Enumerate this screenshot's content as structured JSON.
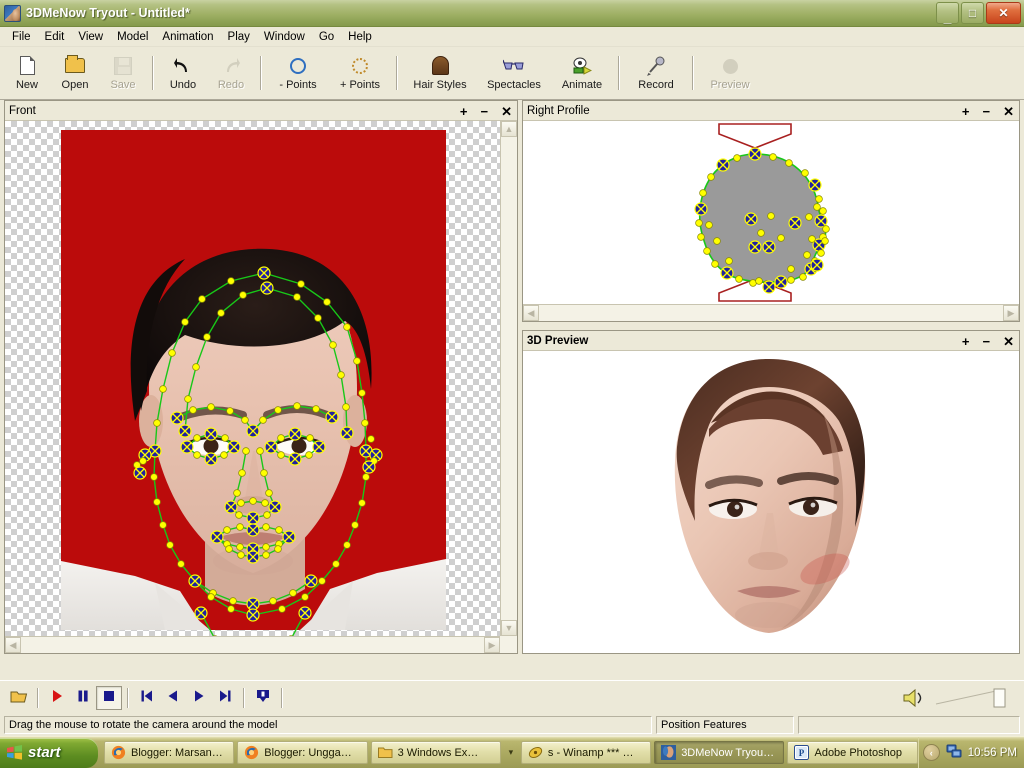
{
  "window": {
    "title": "3DMeNow Tryout  - Untitled*",
    "icon": "app-face-icon",
    "controls": {
      "minimize": "_",
      "maximize": "□",
      "close": "✕"
    }
  },
  "menubar": {
    "items": [
      "File",
      "Edit",
      "View",
      "Model",
      "Animation",
      "Play",
      "Window",
      "Go",
      "Help"
    ]
  },
  "toolbar": {
    "buttons": [
      {
        "label": "New",
        "icon": "new-document-icon",
        "disabled": false
      },
      {
        "label": "Open",
        "icon": "open-folder-icon",
        "disabled": false
      },
      {
        "label": "Save",
        "icon": "floppy-disk-icon",
        "disabled": true
      },
      {
        "label": "Undo",
        "icon": "undo-arrow-icon",
        "disabled": false
      },
      {
        "label": "Redo",
        "icon": "redo-arrow-icon",
        "disabled": true
      },
      {
        "label": "- Points",
        "icon": "minus-points-icon",
        "disabled": false
      },
      {
        "label": "+ Points",
        "icon": "plus-points-icon",
        "disabled": false
      },
      {
        "label": "Hair Styles",
        "icon": "hair-icon",
        "disabled": false
      },
      {
        "label": "Spectacles",
        "icon": "glasses-icon",
        "disabled": false
      },
      {
        "label": "Animate",
        "icon": "animate-icon",
        "disabled": false
      },
      {
        "label": "Record",
        "icon": "microphone-icon",
        "disabled": false
      },
      {
        "label": "Preview",
        "icon": "preview-icon",
        "disabled": true
      }
    ]
  },
  "panels": {
    "front": {
      "title": "Front",
      "controls": {
        "plus": "+",
        "minus": "−",
        "close": "✕"
      }
    },
    "right_profile": {
      "title": "Right Profile",
      "controls": {
        "plus": "+",
        "minus": "−",
        "close": "✕"
      }
    },
    "preview3d": {
      "title": "3D Preview",
      "controls": {
        "plus": "+",
        "minus": "−",
        "close": "✕"
      }
    }
  },
  "transport": {
    "buttons": [
      {
        "name": "open-animation",
        "icon": "open-folder-icon",
        "state": "normal"
      },
      {
        "name": "play",
        "icon": "play-triangle-icon",
        "state": "normal"
      },
      {
        "name": "pause",
        "icon": "pause-bars-icon",
        "state": "normal"
      },
      {
        "name": "stop",
        "icon": "stop-square-icon",
        "state": "pressed"
      },
      {
        "name": "skip-to-start",
        "icon": "skip-start-icon",
        "state": "normal"
      },
      {
        "name": "step-back",
        "icon": "step-back-icon",
        "state": "normal"
      },
      {
        "name": "step-forward",
        "icon": "step-forward-icon",
        "state": "normal"
      },
      {
        "name": "skip-to-end",
        "icon": "skip-end-icon",
        "state": "normal"
      },
      {
        "name": "loop",
        "icon": "loop-icon",
        "state": "normal"
      }
    ],
    "volume": {
      "icon": "speaker-icon",
      "value": 100
    }
  },
  "statusbar": {
    "hint": "Drag the mouse to rotate the camera around the model",
    "mode": "Position Features",
    "extra": ""
  },
  "taskbar": {
    "start": "start",
    "items": [
      {
        "label": "Blogger: Marsan…",
        "icon": "firefox-icon",
        "active": false
      },
      {
        "label": "Blogger: Ungga…",
        "icon": "firefox-icon",
        "active": false
      },
      {
        "label": "3 Windows Ex…",
        "icon": "folder-icon",
        "active": false,
        "group": true
      },
      {
        "label": "s - Winamp *** …",
        "icon": "winamp-icon",
        "active": false
      },
      {
        "label": "3DMeNow Tryou…",
        "icon": "app-face-icon",
        "active": true
      },
      {
        "label": "Adobe Photoshop",
        "icon": "photoshop-icon",
        "active": false
      }
    ],
    "tray": {
      "chevron": "‹",
      "network_icon": "network-icon",
      "clock": "10:56 PM"
    }
  },
  "colors": {
    "title_bar": "#9fb065",
    "face_point_outer": "#ffff00",
    "face_point_anchor": "#2020a0",
    "mesh_line": "#00c000",
    "photo_background": "#c00000",
    "profile_silhouette": "#9a9a9a",
    "profile_marker": "#a02020"
  }
}
